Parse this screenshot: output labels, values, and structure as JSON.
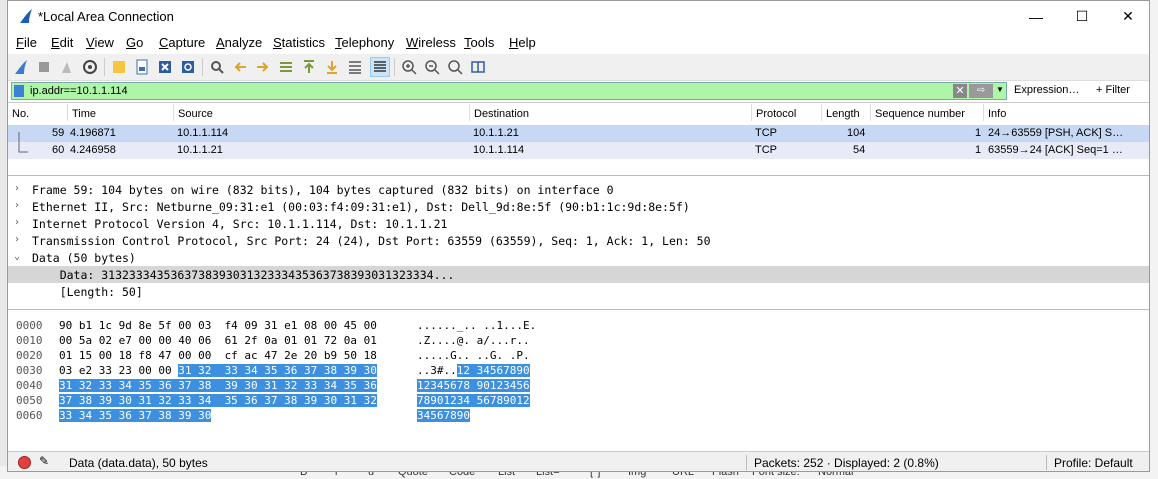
{
  "window": {
    "title": "*Local Area Connection",
    "minimize": "—",
    "maximize": "☐",
    "close": "✕"
  },
  "menu": [
    "File",
    "Edit",
    "View",
    "Go",
    "Capture",
    "Analyze",
    "Statistics",
    "Telephony",
    "Wireless",
    "Tools",
    "Help"
  ],
  "filter": {
    "value": "ip.addr==10.1.1.114",
    "expression_label": "Expression…",
    "filter_label": "+ Filter",
    "clear": "✕",
    "apply": "⇨"
  },
  "packet_list": {
    "columns": [
      "No.",
      "Time",
      "Source",
      "Destination",
      "Protocol",
      "Length",
      "Sequence number",
      "Info"
    ],
    "rows": [
      {
        "no": "59",
        "time": "4.196871",
        "source": "10.1.1.114",
        "destination": "10.1.1.21",
        "protocol": "TCP",
        "length": "104",
        "seq": "1",
        "info": "24→63559 [PSH, ACK] S…"
      },
      {
        "no": "60",
        "time": "4.246958",
        "source": "10.1.1.21",
        "destination": "10.1.1.114",
        "protocol": "TCP",
        "length": "54",
        "seq": "1",
        "info": "63559→24 [ACK] Seq=1 …"
      }
    ]
  },
  "details": [
    {
      "arrow": "›",
      "text": "Frame 59: 104 bytes on wire (832 bits), 104 bytes captured (832 bits) on interface 0"
    },
    {
      "arrow": "›",
      "text": "Ethernet II, Src: Netburne_09:31:e1 (00:03:f4:09:31:e1), Dst: Dell_9d:8e:5f (90:b1:1c:9d:8e:5f)"
    },
    {
      "arrow": "›",
      "text": "Internet Protocol Version 4, Src: 10.1.1.114, Dst: 10.1.1.21"
    },
    {
      "arrow": "›",
      "text": "Transmission Control Protocol, Src Port: 24 (24), Dst Port: 63559 (63559), Seq: 1, Ack: 1, Len: 50"
    },
    {
      "arrow": "⌄",
      "text": "Data (50 bytes)"
    },
    {
      "arrow": "",
      "text": "    Data: 313233343536373839303132333435363738393031323334..."
    },
    {
      "arrow": "",
      "text": "    [Length: 50]"
    }
  ],
  "hex": [
    {
      "off": "0000",
      "pre": "90 b1 1c 9d 8e 5f 00 03  f4 09 31 e1 08 00 45 00",
      "sel": "",
      "apre": "......_.. ..1...E.",
      "asel": ""
    },
    {
      "off": "0010",
      "pre": "00 5a 02 e7 00 00 40 06  61 2f 0a 01 01 72 0a 01",
      "sel": "",
      "apre": ".Z....@. a/...r..",
      "asel": ""
    },
    {
      "off": "0020",
      "pre": "01 15 00 18 f8 47 00 00  cf ac 47 2e 20 b9 50 18",
      "sel": "",
      "apre": ".....G.. ..G. .P.",
      "asel": ""
    },
    {
      "off": "0030",
      "pre": "03 e2 33 23 00 00 ",
      "sel": "31 32  33 34 35 36 37 38 39 30",
      "apre": "..3#..",
      "asel": "12 34567890"
    },
    {
      "off": "0040",
      "pre": "",
      "sel": "31 32 33 34 35 36 37 38  39 30 31 32 33 34 35 36",
      "apre": "",
      "asel": "12345678 90123456"
    },
    {
      "off": "0050",
      "pre": "",
      "sel": "37 38 39 30 31 32 33 34  35 36 37 38 39 30 31 32",
      "apre": "",
      "asel": "78901234 56789012"
    },
    {
      "off": "0060",
      "pre": "",
      "sel": "33 34 35 36 37 38 39 30",
      "apre": "",
      "asel": "34567890"
    }
  ],
  "status": {
    "field": "Data (data.data), 50 bytes",
    "packets": "Packets: 252 · Displayed: 2 (0.8%)",
    "profile": "Profile: Default"
  },
  "background_bottom": [
    "B",
    "i",
    "u",
    "Quote",
    "Code",
    "List",
    "List=",
    "[*]",
    "Img",
    "URL",
    "Flash",
    "Font size:",
    "Normal"
  ]
}
